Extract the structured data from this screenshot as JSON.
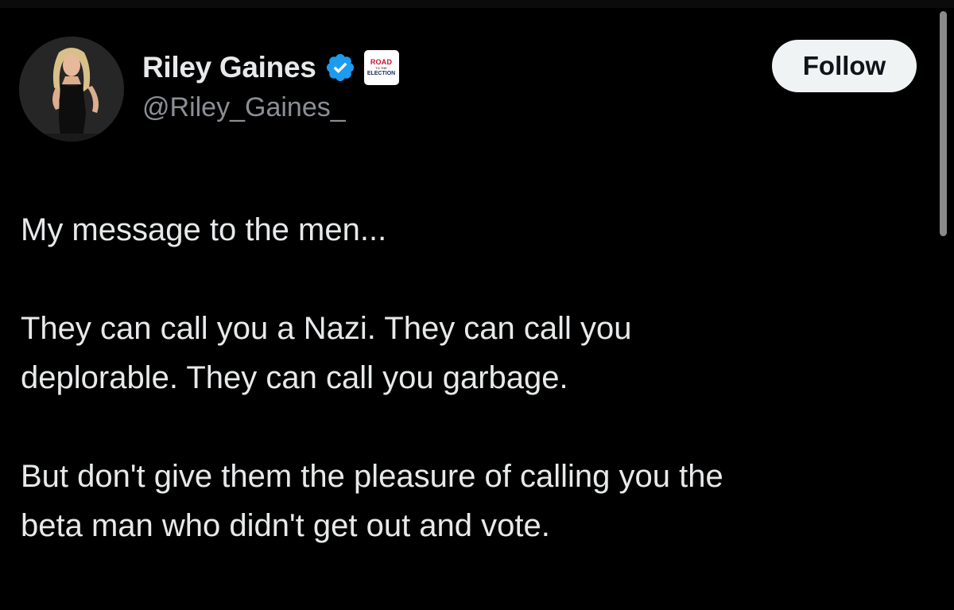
{
  "author": {
    "display_name": "Riley Gaines",
    "handle": "@Riley_Gaines_",
    "verified": true,
    "affiliation_badge": {
      "line1": "ROAD",
      "line2": "TO THE",
      "line3": "ELECTION"
    }
  },
  "follow_button": {
    "label": "Follow"
  },
  "tweet": {
    "paragraphs": [
      [
        "My message to the men..."
      ],
      [
        "They can call you a Nazi. They can call you",
        "deplorable. They can call you garbage."
      ],
      [
        "But don't give them the pleasure of  calling you the",
        "beta man who didn't get out and vote."
      ]
    ]
  },
  "icons": {
    "verified": "verified-check-icon",
    "affiliation": "road-to-the-election-badge-icon"
  },
  "colors": {
    "background": "#000000",
    "text_primary": "#e7e9ea",
    "text_secondary": "#8b8f94",
    "verified_blue": "#1d9bf0",
    "follow_button_bg": "#eff3f4",
    "follow_button_text": "#0f1419"
  }
}
